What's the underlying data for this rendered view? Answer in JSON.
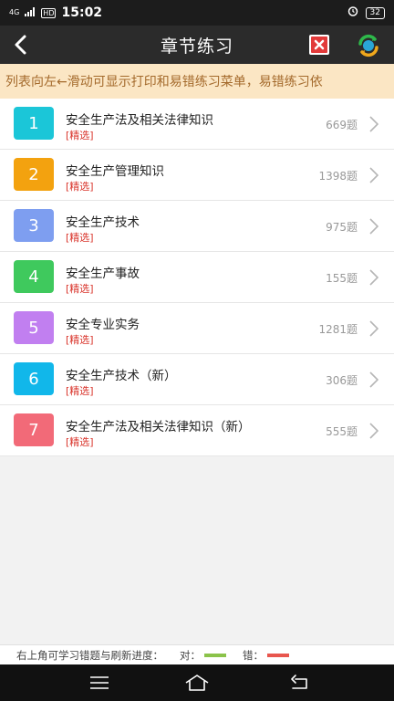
{
  "status_bar": {
    "network": "4G",
    "time": "15:02",
    "hd": "HD",
    "battery": "32"
  },
  "header": {
    "title": "章节练习"
  },
  "notice": {
    "text": "列表向左←滑动可显示打印和易错练习菜单，易错练习依"
  },
  "chapters": [
    {
      "number": "1",
      "title": "安全生产法及相关法律知识",
      "tag": "[精选]",
      "count": "669题",
      "color": "#1bc6d8"
    },
    {
      "number": "2",
      "title": "安全生产管理知识",
      "tag": "[精选]",
      "count": "1398题",
      "color": "#f3a20f"
    },
    {
      "number": "3",
      "title": "安全生产技术",
      "tag": "[精选]",
      "count": "975题",
      "color": "#7e9ef0"
    },
    {
      "number": "4",
      "title": "安全生产事故",
      "tag": "[精选]",
      "count": "155题",
      "color": "#3fc95d"
    },
    {
      "number": "5",
      "title": "安全专业实务",
      "tag": "[精选]",
      "count": "1281题",
      "color": "#c17ff0"
    },
    {
      "number": "6",
      "title": "安全生产技术（新）",
      "tag": "[精选]",
      "count": "306题",
      "color": "#11b7ea"
    },
    {
      "number": "7",
      "title": "安全生产法及相关法律知识（新）",
      "tag": "[精选]",
      "count": "555题",
      "color": "#f26a78"
    }
  ],
  "footer": {
    "hint": "右上角可学习错题与刷新进度：",
    "correct_label": "对：",
    "wrong_label": "错：",
    "correct_color": "#8bc34a",
    "wrong_color": "#e8564e"
  },
  "icons": {
    "back": "back-arrow-icon",
    "mistakes": "mistake-book-icon",
    "refresh": "refresh-icon",
    "chevron": "chevron-right-icon",
    "nav_menu": "menu-icon",
    "nav_home": "home-icon",
    "nav_back": "return-icon"
  }
}
